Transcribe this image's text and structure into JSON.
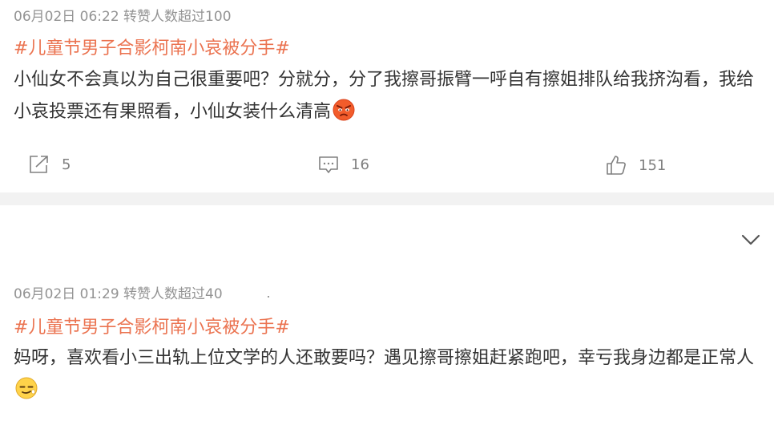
{
  "posts": [
    {
      "meta": "06月02日 06:22 转赞人数超过100",
      "topic": "#儿童节男子合影柯南小哀被分手#",
      "content": "小仙女不会真以为自己很重要吧？分就分，分了我擦哥振臂一呼自有擦姐排队给我挤沟看，我给小哀投票还有果照看，小仙女装什么清高",
      "emoji": "angry-face-emoji",
      "actions": {
        "share_count": "5",
        "comment_count": "16",
        "like_count": "151"
      }
    },
    {
      "meta": "06月02日 01:29 转赞人数超过40",
      "topic": "#儿童节男子合影柯南小哀被分手#",
      "content": "妈呀，喜欢看小三出轨上位文学的人还敢要吗？遇见擦哥擦姐赶紧跑吧，幸亏我身边都是正常人",
      "emoji": "smirk-face-emoji"
    }
  ],
  "icons": {
    "share": "share-icon",
    "comment": "comment-icon",
    "like": "thumbs-up-icon",
    "collapse": "chevron-down-icon"
  },
  "colors": {
    "topic": "#eb7350",
    "meta": "#939393",
    "separator": "#f2f2f2"
  }
}
